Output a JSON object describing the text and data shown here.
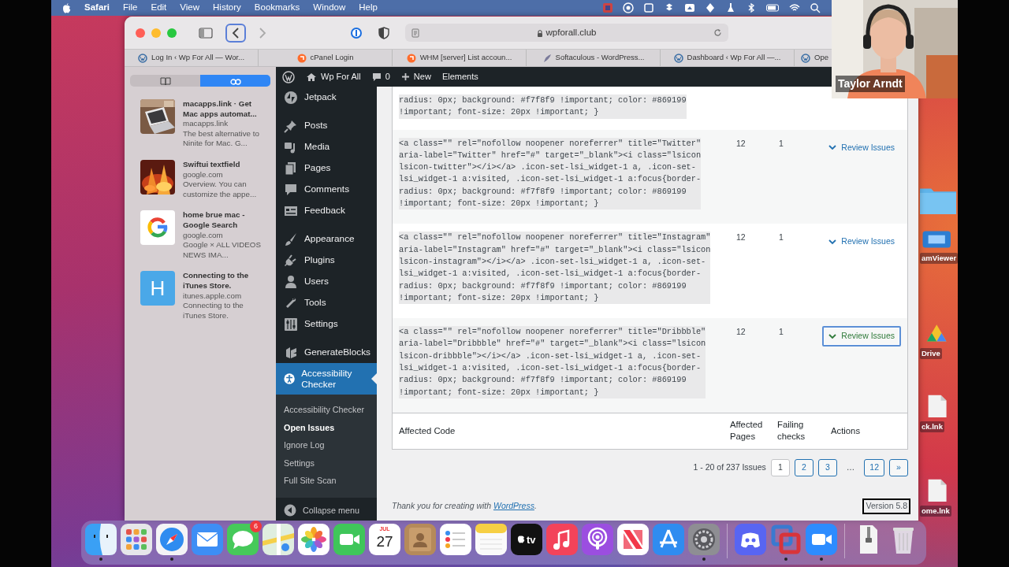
{
  "menubar": {
    "app": "Safari",
    "menus": [
      "File",
      "Edit",
      "View",
      "History",
      "Bookmarks",
      "Window",
      "Help"
    ]
  },
  "webcam": {
    "name": "Taylor Arndt"
  },
  "browser": {
    "address": "wpforall.club",
    "back_focused": true,
    "tabs": [
      {
        "title": "Log In ‹ Wp For All — Wor...",
        "kind": "wordpress"
      },
      {
        "title": "cPanel Login",
        "kind": "cpanel"
      },
      {
        "title": "WHM [server] List accoun...",
        "kind": "cpanel"
      },
      {
        "title": "Softaculous - WordPress...",
        "kind": "softaculous"
      },
      {
        "title": "Dashboard ‹ Wp For All —...",
        "kind": "wordpress"
      },
      {
        "title": "Ope",
        "kind": "wordpress"
      }
    ],
    "sidebar_segments": [
      {
        "kind": "book",
        "selected": false
      },
      {
        "kind": "glasses",
        "selected": true
      }
    ],
    "reading_list": [
      {
        "kind": "laptop-photo",
        "title": "macapps.link · Get Mac apps automat...",
        "domain": "macapps.link",
        "excerpt": "The best alternative to Ninite for Mac. G..."
      },
      {
        "kind": "fire-photo",
        "title": "Swiftui textfield",
        "domain": "google.com",
        "excerpt": "Overview. You can customize the appe..."
      },
      {
        "kind": "g-logo",
        "title": "home brue mac - Google Search",
        "domain": "google.com",
        "excerpt": "Google × ALL VIDEOS NEWS IMA..."
      },
      {
        "kind": "letter",
        "letter": "H",
        "title": "Connecting to the iTunes Store.",
        "domain": "itunes.apple.com",
        "excerpt": "Connecting to the iTunes Store."
      }
    ]
  },
  "wp": {
    "admin_bar": {
      "site": "Wp For All",
      "comments": "0",
      "new": "New",
      "extra": "Elements"
    },
    "menu_groups": [
      [
        {
          "label": "Jetpack",
          "kind": "jetpack",
          "selected": false
        }
      ],
      [
        {
          "label": "Posts",
          "kind": "pin",
          "selected": false
        },
        {
          "label": "Media",
          "kind": "media",
          "selected": false
        },
        {
          "label": "Pages",
          "kind": "pages",
          "selected": false
        },
        {
          "label": "Comments",
          "kind": "comments",
          "selected": false
        },
        {
          "label": "Feedback",
          "kind": "feedback",
          "selected": false
        }
      ],
      [
        {
          "label": "Appearance",
          "kind": "brush",
          "selected": false
        },
        {
          "label": "Plugins",
          "kind": "plug",
          "selected": false
        },
        {
          "label": "Users",
          "kind": "user",
          "selected": false
        },
        {
          "label": "Tools",
          "kind": "wrench",
          "selected": false
        },
        {
          "label": "Settings",
          "kind": "sliders",
          "selected": false
        }
      ],
      [
        {
          "label": "GenerateBlocks",
          "kind": "blocks",
          "selected": false
        },
        {
          "label": "Accessibility Checker",
          "kind": "accessibility",
          "selected": true
        }
      ]
    ],
    "submenu": [
      {
        "label": "Accessibility Checker",
        "selected": false
      },
      {
        "label": "Open Issues",
        "selected": true
      },
      {
        "label": "Ignore Log",
        "selected": false
      },
      {
        "label": "Settings",
        "selected": false
      },
      {
        "label": "Full Site Scan",
        "selected": false
      }
    ],
    "collapse": "Collapse menu",
    "rows": [
      {
        "code": "radius: 0px; background: #f7f8f9 !important; color: #869199\n!important; font-size: 20px !important; }"
      },
      {
        "code": "<a class=\"\" rel=\"nofollow noopener noreferrer\" title=\"Twitter\"\naria-label=\"Twitter\" href=\"#\" target=\"_blank\"><i class=\"lsicon\nlsicon-twitter\"></i></a> .icon-set-lsi_widget-1 a, .icon-set-\nlsi_widget-1 a:visited, .icon-set-lsi_widget-1 a:focus{border-\nradius: 0px; background: #f7f8f9 !important; color: #869199\n!important; font-size: 20px !important; }",
        "pages": "12",
        "checks": "1",
        "action": "Review Issues",
        "focused": false
      },
      {
        "code": "<a class=\"\" rel=\"nofollow noopener noreferrer\" title=\"Instagram\"\naria-label=\"Instagram\" href=\"#\" target=\"_blank\"><i class=\"lsicon\nlsicon-instagram\"></i></a> .icon-set-lsi_widget-1 a, .icon-set-\nlsi_widget-1 a:visited, .icon-set-lsi_widget-1 a:focus{border-\nradius: 0px; background: #f7f8f9 !important; color: #869199\n!important; font-size: 20px !important; }",
        "pages": "12",
        "checks": "1",
        "action": "Review Issues",
        "focused": false
      },
      {
        "code": "<a class=\"\" rel=\"nofollow noopener noreferrer\" title=\"Dribbble\"\naria-label=\"Dribbble\" href=\"#\" target=\"_blank\"><i class=\"lsicon\nlsicon-dribbble\"></i></a> .icon-set-lsi_widget-1 a, .icon-set-\nlsi_widget-1 a:visited, .icon-set-lsi_widget-1 a:focus{border-\nradius: 0px; background: #f7f8f9 !important; color: #869199\n!important; font-size: 20px !important; }",
        "pages": "12",
        "checks": "1",
        "action": "Review Issues",
        "focused": true
      }
    ],
    "columns": [
      "Affected Code",
      "Affected Pages",
      "Failing checks",
      "Actions"
    ],
    "pagination": {
      "summary": "1 - 20 of 237 Issues",
      "pages": [
        {
          "label": "1",
          "selected": true
        },
        {
          "label": "2",
          "selected": false
        },
        {
          "label": "3",
          "selected": false
        },
        {
          "label": "…",
          "kind": "gap"
        },
        {
          "label": "12",
          "selected": false
        },
        {
          "label": "»",
          "selected": false
        }
      ]
    },
    "footer": {
      "text": "Thank you for creating with",
      "link": "WordPress",
      "end": ".",
      "version": "Version 5.8",
      "version_outlined": true
    }
  },
  "desktop_icons": [
    {
      "kind": "folder"
    },
    {
      "kind": "app",
      "label": "amViewer"
    },
    {
      "kind": "drive",
      "label": "Drive"
    },
    {
      "kind": "shortcut",
      "label": "ck.lnk"
    },
    {
      "kind": "shortcut",
      "label": "ome.lnk"
    }
  ],
  "dock_sections": [
    [
      {
        "kind": "finder",
        "running": true
      },
      {
        "kind": "launchpad",
        "running": false
      },
      {
        "kind": "safari",
        "running": true
      },
      {
        "kind": "mail",
        "running": false
      },
      {
        "kind": "messages",
        "running": false,
        "badge": "6"
      },
      {
        "kind": "maps",
        "running": false
      },
      {
        "kind": "photos",
        "running": false
      },
      {
        "kind": "facetime",
        "running": false
      },
      {
        "kind": "calendar",
        "running": false,
        "month": "JUL",
        "day": "27"
      },
      {
        "kind": "contacts",
        "running": false
      },
      {
        "kind": "reminders",
        "running": false
      },
      {
        "kind": "notes",
        "running": false
      },
      {
        "kind": "tv",
        "running": false,
        "label": "tv"
      },
      {
        "kind": "music",
        "running": false
      },
      {
        "kind": "podcasts",
        "running": false
      },
      {
        "kind": "news",
        "running": false
      },
      {
        "kind": "appstore",
        "running": false
      },
      {
        "kind": "settings",
        "running": true
      }
    ],
    [
      {
        "kind": "discord",
        "running": false
      },
      {
        "kind": "vm",
        "running": true
      },
      {
        "kind": "zoom",
        "running": true
      }
    ],
    [
      {
        "kind": "archive",
        "running": false
      },
      {
        "kind": "trash",
        "running": false
      }
    ]
  ]
}
